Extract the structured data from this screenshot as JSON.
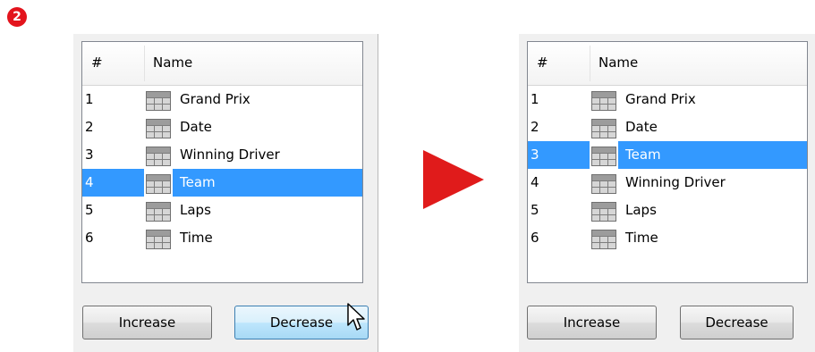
{
  "step_badge": "2",
  "header": {
    "num": "#",
    "name": "Name"
  },
  "before": {
    "rows": [
      {
        "num": "1",
        "name": "Grand Prix",
        "selected": false
      },
      {
        "num": "2",
        "name": "Date",
        "selected": false
      },
      {
        "num": "3",
        "name": "Winning Driver",
        "selected": false
      },
      {
        "num": "4",
        "name": "Team",
        "selected": true
      },
      {
        "num": "5",
        "name": "Laps",
        "selected": false
      },
      {
        "num": "6",
        "name": "Time",
        "selected": false
      }
    ],
    "buttons": {
      "increase": "Increase",
      "decrease": "Decrease"
    }
  },
  "after": {
    "rows": [
      {
        "num": "1",
        "name": "Grand Prix",
        "selected": false
      },
      {
        "num": "2",
        "name": "Date",
        "selected": false
      },
      {
        "num": "3",
        "name": "Team",
        "selected": true
      },
      {
        "num": "4",
        "name": "Winning Driver",
        "selected": false
      },
      {
        "num": "5",
        "name": "Laps",
        "selected": false
      },
      {
        "num": "6",
        "name": "Time",
        "selected": false
      }
    ],
    "buttons": {
      "increase": "Increase",
      "decrease": "Decrease"
    }
  },
  "icons": {
    "row_icon": "table-icon",
    "transition": "arrow-right-icon",
    "pointer": "mouse-cursor-icon"
  },
  "colors": {
    "selection": "#3399ff",
    "arrow": "#e01b1b",
    "badge": "#e3141d"
  }
}
